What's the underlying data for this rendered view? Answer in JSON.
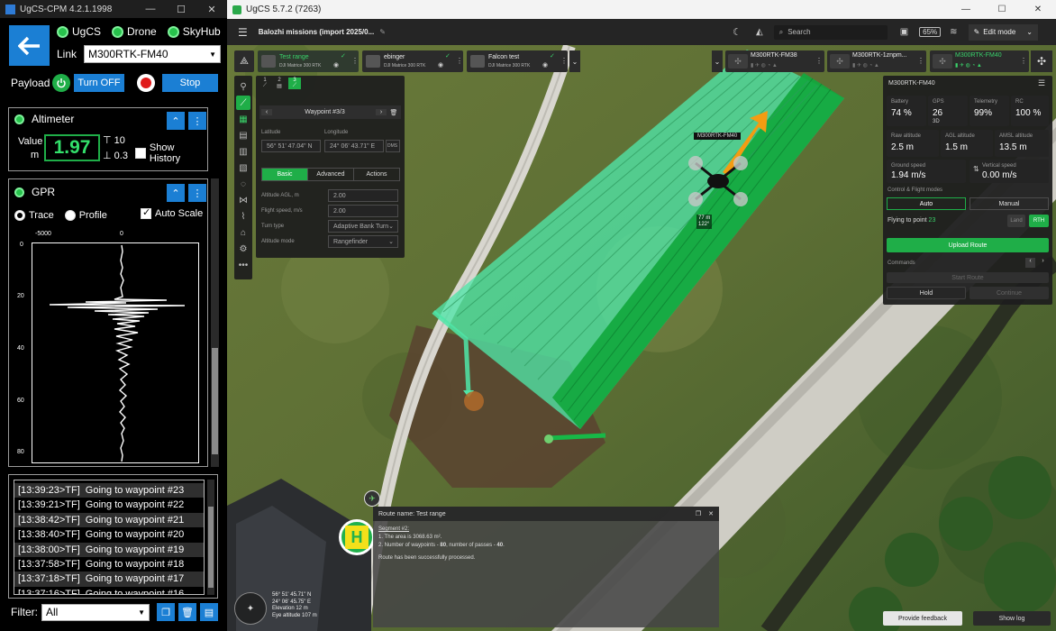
{
  "cpm": {
    "title": "UgCS-CPM 4.2.1.1998",
    "status": [
      "UgCS",
      "Drone",
      "SkyHub"
    ],
    "link_label": "Link",
    "link_value": "M300RTK-FM40",
    "payload_label": "Payload",
    "turn_off": "Turn OFF",
    "stop": "Stop",
    "altimeter": {
      "title": "Altimeter",
      "value_label": "Value",
      "unit": "m",
      "value": "1.97",
      "upper": "10",
      "lower": "0.3",
      "show_history": "Show History"
    },
    "gpr": {
      "title": "GPR",
      "trace": "Trace",
      "profile": "Profile",
      "auto_scale": "Auto Scale",
      "x_ticks": [
        "-5000",
        "0"
      ],
      "y_ticks": [
        "0",
        "20",
        "40",
        "60",
        "80"
      ]
    },
    "log": [
      {
        "time": "[13:39:23>TF]",
        "msg": "Going to waypoint #23"
      },
      {
        "time": "[13:39:21>TF]",
        "msg": "Going to waypoint #22"
      },
      {
        "time": "[13:38:42>TF]",
        "msg": "Going to waypoint #21"
      },
      {
        "time": "[13:38:40>TF]",
        "msg": "Going to waypoint #20"
      },
      {
        "time": "[13:38:00>TF]",
        "msg": "Going to waypoint #19"
      },
      {
        "time": "[13:37:58>TF]",
        "msg": "Going to waypoint #18"
      },
      {
        "time": "[13:37:18>TF]",
        "msg": "Going to waypoint #17"
      },
      {
        "time": "[13:37:16>TF]",
        "msg": "Going to waypoint #16"
      }
    ],
    "filter_label": "Filter:",
    "filter_value": "All"
  },
  "ugcs": {
    "title": "UgCS 5.7.2 (7263)",
    "mission": "Balozhi missions (import 2025/0...",
    "search_placeholder": "Search",
    "battery": "65%",
    "mode": "Edit mode",
    "routes": [
      {
        "name": "Test range",
        "sub": "DJI Matrice 300 RTK"
      },
      {
        "name": "ebinger",
        "sub": "DJI Matrice 300 RTK"
      },
      {
        "name": "Falcon test",
        "sub": "DJI Matrice 300 RTK"
      }
    ],
    "vehicles": [
      "M300RTK-FM38",
      "M300RTK-1znpm...",
      "M300RTK-FM40"
    ],
    "tool_tabs": [
      "1",
      "2",
      "3"
    ],
    "waypoint": {
      "title": "Waypoint #3/3",
      "lat_label": "Latitude",
      "lat": "56° 51' 47.04\" N",
      "lon_label": "Longitude",
      "lon": "24° 06' 43.71\" E",
      "dms": "DMS",
      "tabs": [
        "Basic",
        "Advanced",
        "Actions"
      ],
      "fields": [
        {
          "label": "Altitude AGL, m",
          "value": "2.00"
        },
        {
          "label": "Flight speed, m/s",
          "value": "2.00"
        },
        {
          "label": "Turn type",
          "value": "Adaptive Bank Turn"
        },
        {
          "label": "Altitude mode",
          "value": "Rangefinder"
        }
      ]
    },
    "telemetry": {
      "title": "M300RTK-FM40",
      "battery_label": "Battery",
      "battery": "74 %",
      "gps_label": "GPS",
      "gps": "26",
      "gps_sub": "3D",
      "telemetry_label": "Telemetry",
      "telemetry": "99%",
      "rc_label": "RC",
      "rc": "100 %",
      "raw_alt_label": "Raw altitude",
      "raw_alt": "2.5 m",
      "agl_label": "AGL altitude",
      "agl": "1.5 m",
      "amsl_label": "AMSL altitude",
      "amsl": "13.5 m",
      "gs_label": "Ground speed",
      "gs": "1.94 m/s",
      "vs_label": "Vertical speed",
      "vs": "0.00 m/s",
      "modes_label": "Control & Flight modes",
      "auto": "Auto",
      "manual": "Manual",
      "flying": "Flying to point",
      "flying_pt": "23",
      "land": "Land",
      "rth": "RTH",
      "upload": "Upload Route",
      "commands": "Commands",
      "start_route": "Start Route",
      "hold": "Hold",
      "continue": "Continue"
    },
    "drone_label": "M300RTK-FM40",
    "drone_alt": "77 m",
    "drone_alt2": "122°",
    "route_panel": {
      "title": "Route name: Test range",
      "segment": "Segment #2:",
      "line1_a": "1. The area is 3068.63 m².",
      "line2_a": "2. Number of waypoints - ",
      "line2_b": "80",
      "line2_c": ", number of passes - ",
      "line2_d": "40",
      "line2_e": ".",
      "line3": "Route has been successfully processed."
    },
    "coords": {
      "lat": "56° 51' 45.71\" N",
      "lon": "24° 06' 45.75\" E",
      "elev": "Elevation 12 m",
      "eye": "Eye altitude 107 m"
    },
    "feedback": "Provide feedback",
    "show_log": "Show log",
    "colors": {
      "accent_green": "#1fae48",
      "route_light": "#4fe6a8",
      "route_dark": "#12a83e",
      "blue": "#1b7fd4"
    }
  }
}
